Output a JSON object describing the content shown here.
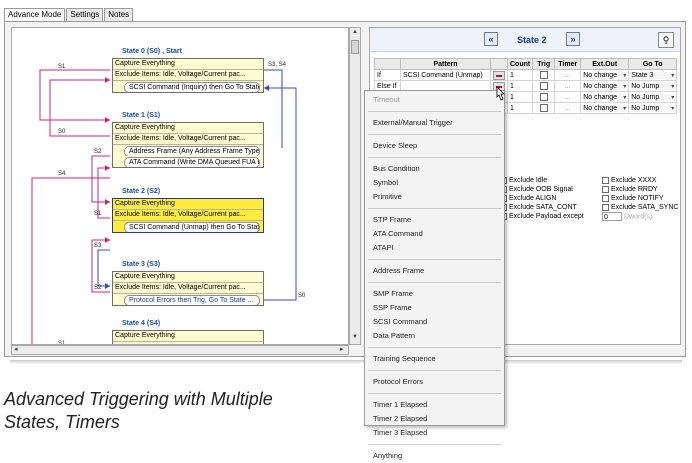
{
  "tabs": [
    {
      "label": "Advance Mode",
      "active": true
    },
    {
      "label": "Settings",
      "active": false
    },
    {
      "label": "Notes",
      "active": false
    }
  ],
  "diagram": {
    "states": [
      {
        "title": "State 0 (S0) , Start",
        "rows": [
          "Capture Everything",
          "Exclude Items: Idle, Voltage/Current pac..."
        ],
        "conditions": [
          "SCSI Command (Inquiry) then Go To State..."
        ],
        "selected": false
      },
      {
        "title": "State 1 (S1)",
        "rows": [
          "Capture Everything",
          "Exclude Items: Idle, Voltage/Current pac..."
        ],
        "conditions": [
          "Address Frame (Any Address Frame Type) ...",
          "ATA Command (Write DMA Queued FUA Ext) ..."
        ],
        "selected": false
      },
      {
        "title": "State 2 (S2)",
        "rows": [
          "Capture Everything",
          "Exclude Items: Idle, Voltage/Current pac..."
        ],
        "conditions": [
          "SCSI Command (Unmap) then Go To State 3..."
        ],
        "selected": true
      },
      {
        "title": "State 3 (S3)",
        "rows": [
          "Capture Everything",
          "Exclude Items: Idle, Voltage/Current pac..."
        ],
        "conditions": [
          "Protocol Errors then Trig, Go To State ..."
        ],
        "selected": false
      },
      {
        "title": "State 4 (S4)",
        "rows": [
          "Capture Everything"
        ],
        "conditions": [],
        "selected": false
      }
    ],
    "edge_labels": [
      "S1",
      "S3, S4",
      "S0",
      "S2",
      "S4",
      "S1",
      "S3",
      "S2",
      "S0",
      "S1"
    ]
  },
  "state_nav": {
    "label": "State 2",
    "prev": "«",
    "next": "»",
    "tool_icon": "⚲"
  },
  "grid": {
    "headers": [
      "",
      "Pattern",
      "",
      "Count",
      "Trig",
      "Timer",
      "Ext.Out",
      "Go To"
    ],
    "rows": [
      {
        "cond": "If",
        "pattern": "SCSI Command (Unmap)",
        "count": "1",
        "trig": false,
        "timer": "...",
        "ext_out": "No change",
        "goto": "State 3"
      },
      {
        "cond": "Else If",
        "pattern": "",
        "count": "1",
        "trig": false,
        "timer": "...",
        "ext_out": "No change",
        "goto": "No Jump"
      },
      {
        "cond": "",
        "pattern": "",
        "count": "1",
        "trig": false,
        "timer": "...",
        "ext_out": "No change",
        "goto": "No Jump"
      },
      {
        "cond": "",
        "pattern": "",
        "count": "1",
        "trig": false,
        "timer": "...",
        "ext_out": "No change",
        "goto": "No Jump"
      }
    ]
  },
  "options_left": [
    {
      "label": "Exclude Idle",
      "checked": true
    },
    {
      "label": "Exclude OOB Signal",
      "checked": false
    },
    {
      "label": "Exclude ALIGN",
      "checked": false
    },
    {
      "label": "Exclude SATA_CONT",
      "checked": false
    },
    {
      "label": "Exclude Payload except",
      "checked": false
    }
  ],
  "options_right": [
    {
      "label": "Exclude XXXX",
      "checked": false
    },
    {
      "label": "Exclude RRDY",
      "checked": false
    },
    {
      "label": "Exclude NOTIFY",
      "checked": false
    },
    {
      "label": "Exclude SATA_SYNC",
      "checked": false
    }
  ],
  "payload": {
    "value": "0",
    "unit": "Dword(s)"
  },
  "menu": {
    "groups": [
      [
        "Timeout"
      ],
      [
        "External/Manual Trigger"
      ],
      [
        "Device Sleep"
      ],
      [
        "Bus Condition",
        "Symbol",
        "Primitive"
      ],
      [
        "STP Frame",
        "ATA Command",
        "ATAPI"
      ],
      [
        "Address Frame"
      ],
      [
        "SMP Frame",
        "SSP Frame",
        "SCSI Command",
        "Data Pattern"
      ],
      [
        "Training Sequence"
      ],
      [
        "Protocol Errors"
      ],
      [
        "Timer 1 Elapsed",
        "Timer 2 Elapsed",
        "Timer 3 Elapsed"
      ],
      [
        "Anything"
      ]
    ],
    "disabled": [
      "Timeout"
    ]
  },
  "caption": "Advanced Triggering with Multiple States, Timers",
  "colors": {
    "accent": "#1a3aa8",
    "state_box": "#fffbd0",
    "state_selected": "#ffec3c",
    "edge_pink": "#c8287a",
    "edge_blue": "#3a4ab8"
  }
}
